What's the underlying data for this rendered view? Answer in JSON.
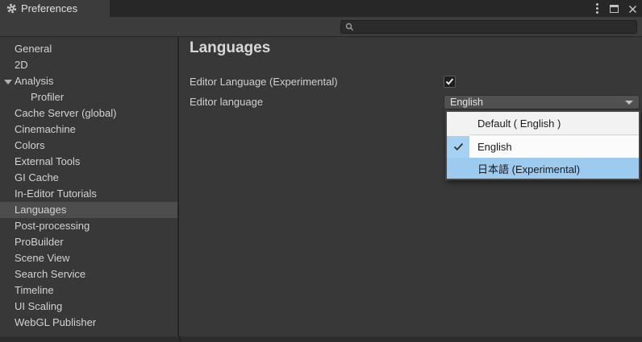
{
  "window": {
    "tab_title": "Preferences"
  },
  "search": {
    "placeholder": ""
  },
  "sidebar": {
    "items": [
      {
        "label": "General"
      },
      {
        "label": "2D"
      },
      {
        "label": "Analysis",
        "expanded": true
      },
      {
        "label": "Profiler",
        "indent": true
      },
      {
        "label": "Cache Server (global)"
      },
      {
        "label": "Cinemachine"
      },
      {
        "label": "Colors"
      },
      {
        "label": "External Tools"
      },
      {
        "label": "GI Cache"
      },
      {
        "label": "In-Editor Tutorials"
      },
      {
        "label": "Languages",
        "selected": true
      },
      {
        "label": "Post-processing"
      },
      {
        "label": "ProBuilder"
      },
      {
        "label": "Scene View"
      },
      {
        "label": "Search Service"
      },
      {
        "label": "Timeline"
      },
      {
        "label": "UI Scaling"
      },
      {
        "label": "WebGL Publisher"
      }
    ]
  },
  "main": {
    "title": "Languages",
    "fields": [
      {
        "label": "Editor Language (Experimental)",
        "type": "checkbox",
        "checked": true
      },
      {
        "label": "Editor language",
        "type": "dropdown",
        "value": "English"
      }
    ]
  },
  "menu": {
    "items": [
      {
        "label": "Default ( English )"
      },
      {
        "label": "English",
        "checked": true
      },
      {
        "label": "日本語 (Experimental)",
        "highlighted": true
      }
    ]
  },
  "colors": {
    "panel_bg": "#383838",
    "selected_row_bg": "#4d4d4d",
    "menu_bg": "#f2f2f2",
    "highlight_blue": "#9dcbf0"
  }
}
